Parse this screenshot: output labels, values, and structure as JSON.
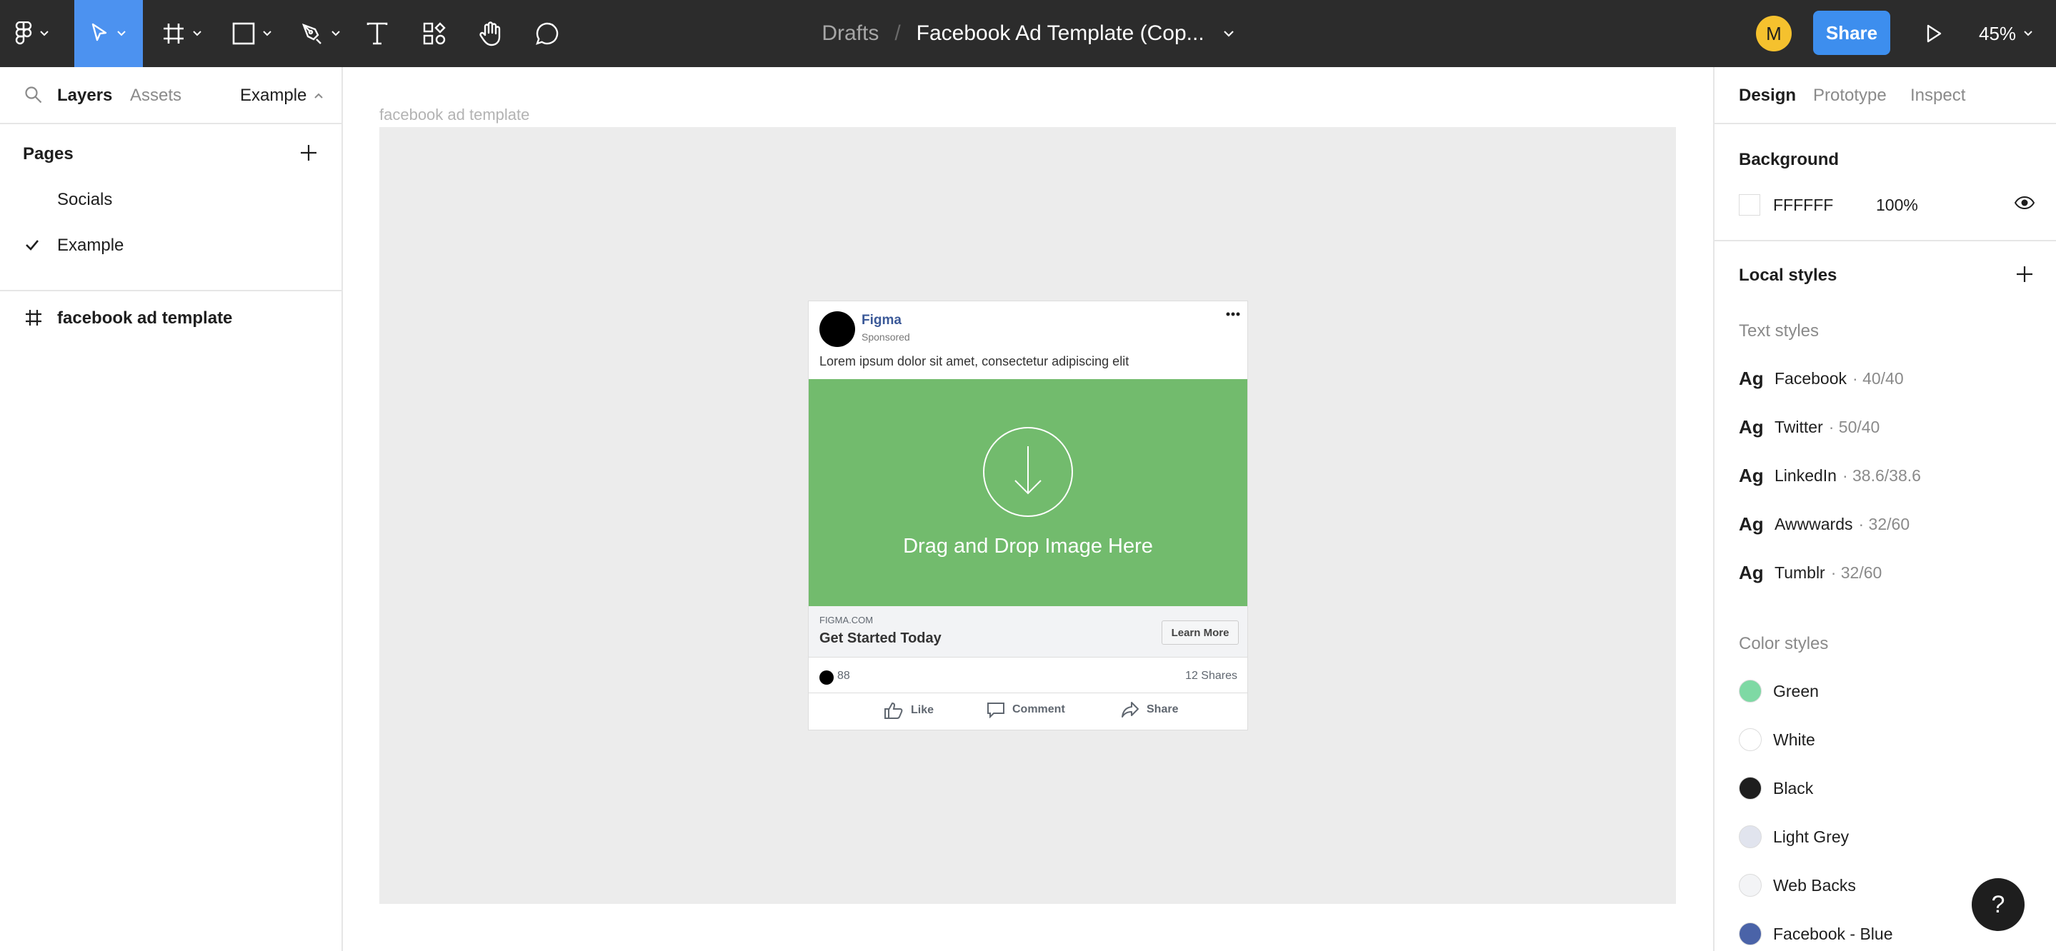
{
  "toolbar": {
    "tools": [
      {
        "icon": "figma-menu-icon"
      },
      {
        "icon": "move-tool-icon",
        "active": true
      },
      {
        "icon": "frame-tool-icon"
      },
      {
        "icon": "rectangle-tool-icon"
      },
      {
        "icon": "pen-tool-icon"
      },
      {
        "icon": "text-tool-icon"
      },
      {
        "icon": "resources-icon"
      },
      {
        "icon": "hand-tool-icon"
      },
      {
        "icon": "comment-tool-icon"
      }
    ],
    "breadcrumb": {
      "folder": "Drafts",
      "separator": "/",
      "file": "Facebook Ad Template (Cop..."
    },
    "avatar_initial": "M",
    "avatar_color": "#f5c12e",
    "share_label": "Share",
    "share_color": "#3d8eee",
    "zoom": "45%"
  },
  "left_panel": {
    "tabs": [
      "Layers",
      "Assets"
    ],
    "active_tab": "Layers",
    "current_page": "Example",
    "pages_title": "Pages",
    "pages": [
      {
        "name": "Socials",
        "selected": false
      },
      {
        "name": "Example",
        "selected": true
      }
    ],
    "layers": [
      {
        "name": "facebook ad template",
        "icon": "frame-hash-icon"
      }
    ]
  },
  "canvas": {
    "frame_label": "facebook ad template",
    "ad": {
      "brand": "Figma",
      "sponsored": "Sponsored",
      "body": "Lorem ipsum dolor sit amet, consectetur adipiscing elit",
      "image_placeholder": "Drag and Drop Image Here",
      "image_color": "#72bb6d",
      "domain": "FIGMA.COM",
      "headline": "Get Started Today",
      "cta": "Learn More",
      "reactions": "88",
      "shares": "12 Shares",
      "actions": [
        "Like",
        "Comment",
        "Share"
      ]
    }
  },
  "right_panel": {
    "tabs": [
      "Design",
      "Prototype",
      "Inspect"
    ],
    "active_tab": "Design",
    "background": {
      "title": "Background",
      "hex": "FFFFFF",
      "opacity": "100%"
    },
    "local_styles_title": "Local styles",
    "text_styles_title": "Text styles",
    "text_styles": [
      {
        "glyph": "Ag",
        "name": "Facebook",
        "meta": "· 40/40"
      },
      {
        "glyph": "Ag",
        "name": "Twitter",
        "meta": "· 50/40"
      },
      {
        "glyph": "Ag",
        "name": "LinkedIn",
        "meta": "· 38.6/38.6"
      },
      {
        "glyph": "Ag",
        "name": "Awwwards",
        "meta": "· 32/60"
      },
      {
        "glyph": "Ag",
        "name": "Tumblr",
        "meta": "· 32/60"
      }
    ],
    "color_styles_title": "Color styles",
    "color_styles": [
      {
        "name": "Green",
        "color": "#7ed9a4"
      },
      {
        "name": "White",
        "color": "#ffffff"
      },
      {
        "name": "Black",
        "color": "#1e1e1e"
      },
      {
        "name": "Light Grey",
        "color": "#e1e4ee"
      },
      {
        "name": "Web Backs",
        "color": "#f3f4f6"
      },
      {
        "name": "Facebook - Blue",
        "color": "#4a63a8"
      }
    ]
  },
  "help_label": "?"
}
